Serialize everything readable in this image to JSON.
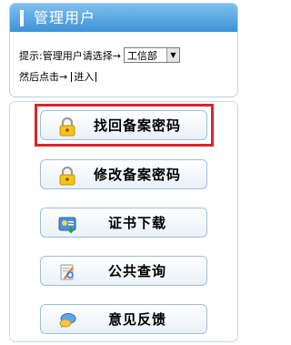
{
  "header": {
    "title": "管理用户"
  },
  "login": {
    "hint_label": "提示:管理用户请选择→",
    "dept_selected": "工信部",
    "next_label": "然后点击→",
    "enter_label": "进入"
  },
  "menu": {
    "items": [
      {
        "label": "找回备案密码",
        "icon": "lock-icon"
      },
      {
        "label": "修改备案密码",
        "icon": "lock-icon"
      },
      {
        "label": "证书下载",
        "icon": "certificate-download-icon"
      },
      {
        "label": "公共查询",
        "icon": "query-icon"
      },
      {
        "label": "意见反馈",
        "icon": "feedback-chat-icon"
      }
    ]
  },
  "colors": {
    "header_gradient_top": "#7fc0ee",
    "header_gradient_bottom": "#3d93d6",
    "highlight_border": "#d8262c",
    "button_border": "#9dbfdd"
  }
}
